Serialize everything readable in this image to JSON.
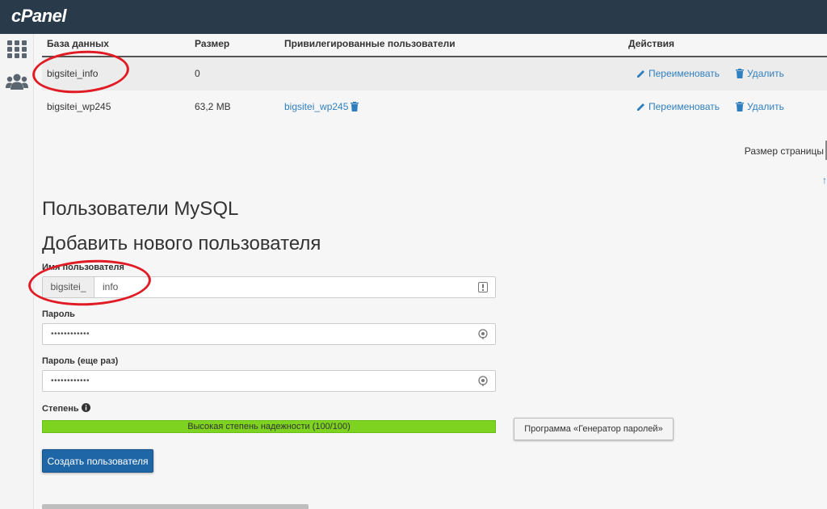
{
  "app": {
    "logo_text": "cPanel"
  },
  "sidebar": {
    "icons": [
      "grid-icon",
      "users-icon"
    ]
  },
  "db_table": {
    "columns": [
      "База данных",
      "Размер",
      "Привилегированные пользователи",
      "Действия"
    ],
    "rows": [
      {
        "database": "bigsitei_info",
        "size": "0",
        "users": "",
        "rename": "Переименовать",
        "delete": "Удалить"
      },
      {
        "database": "bigsitei_wp245",
        "size": "63,2 MB",
        "users": "bigsitei_wp245",
        "rename": "Переименовать",
        "delete": "Удалить"
      }
    ]
  },
  "pagination": {
    "page_size_label": "Размер страницы",
    "up_arrow": "↑"
  },
  "mysql_users": {
    "title": "Пользователи MySQL",
    "add_title": "Добавить нового пользователя",
    "username_label": "Имя пользователя",
    "username_prefix": "bigsitei_",
    "username_value": "info",
    "password_label": "Пароль",
    "password_value": "••••••••••••",
    "password2_label": "Пароль (еще раз)",
    "password2_value": "••••••••••••",
    "strength_label": "Степень",
    "strength_text": "Высокая степень надежности (100/100)",
    "strength_percent": 100,
    "generator_button": "Программа «Генератор паролей»",
    "create_button": "Создать пользователя"
  },
  "colors": {
    "header": "#293a4a",
    "link": "#2f7fbf",
    "strength": "#7ed321",
    "primary_button": "#1f66a7",
    "annotation": "#e01b24"
  }
}
